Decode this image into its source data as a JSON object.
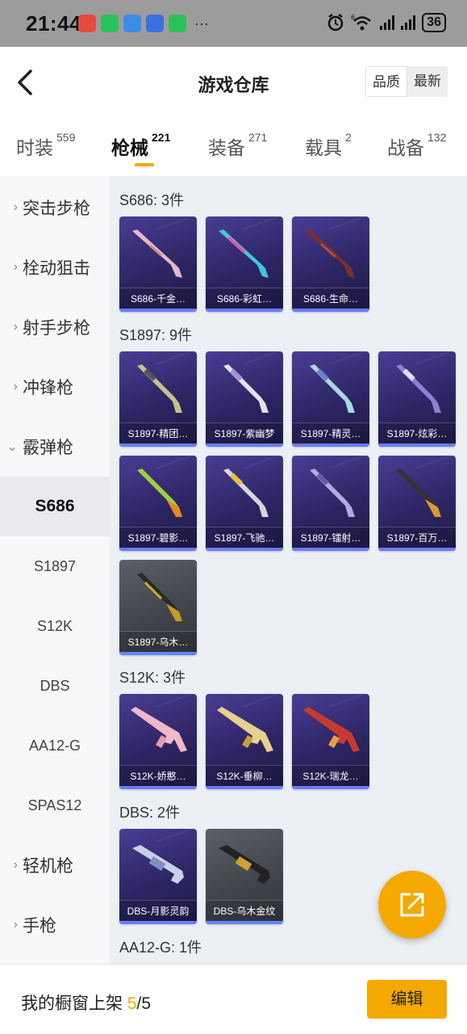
{
  "status_bar": {
    "time": "21:44",
    "more": "···",
    "battery": "36",
    "network_badge": "6"
  },
  "header": {
    "title": "游戏仓库",
    "sort_options": [
      "品质",
      "最新"
    ],
    "active_sort": "品质"
  },
  "tabs": [
    {
      "label": "时装",
      "count": "559"
    },
    {
      "label": "枪械",
      "count": "221"
    },
    {
      "label": "装备",
      "count": "271"
    },
    {
      "label": "载具",
      "count": "2"
    },
    {
      "label": "战备",
      "count": "132"
    }
  ],
  "sidebar": {
    "items": [
      {
        "label": "突击步枪",
        "chevron": "›"
      },
      {
        "label": "栓动狙击",
        "chevron": "›"
      },
      {
        "label": "射手步枪",
        "chevron": "›"
      },
      {
        "label": "冲锋枪",
        "chevron": "›"
      },
      {
        "label": "霰弹枪",
        "chevron": "⌄"
      },
      {
        "label": "S686"
      },
      {
        "label": "S1897"
      },
      {
        "label": "S12K"
      },
      {
        "label": "DBS"
      },
      {
        "label": "AA12-G"
      },
      {
        "label": "SPAS12"
      },
      {
        "label": "轻机枪",
        "chevron": "›"
      },
      {
        "label": "手枪",
        "chevron": "›"
      }
    ],
    "selected": "S686"
  },
  "groups": [
    {
      "title": "S686: 3件",
      "items": [
        "S686-千金…",
        "S686-彩虹…",
        "S686-生命…"
      ]
    },
    {
      "title": "S1897: 9件",
      "items": [
        "S1897-精团…",
        "S1897-紫幽梦",
        "S1897-精灵…",
        "S1897-炫彩…",
        "S1897-碧影…",
        "S1897-飞驰…",
        "S1897-镭射…",
        "S1897-百万…",
        "S1897-乌木…"
      ]
    },
    {
      "title": "S12K: 3件",
      "items": [
        "S12K-娇憨…",
        "S12K-垂柳…",
        "S12K-瑞龙…"
      ]
    },
    {
      "title": "DBS: 2件",
      "items": [
        "DBS-月影灵韵",
        "DBS-乌木金纹"
      ]
    },
    {
      "title": "AA12-G: 1件",
      "items": []
    }
  ],
  "bottom_bar": {
    "label": "我的橱窗上架",
    "shelf_current": "5",
    "shelf_total": "/5",
    "edit_label": "编辑"
  },
  "colors": {
    "accent": "#f5a800",
    "card_purple": "#2d2563",
    "card_gray": "#40444a"
  }
}
